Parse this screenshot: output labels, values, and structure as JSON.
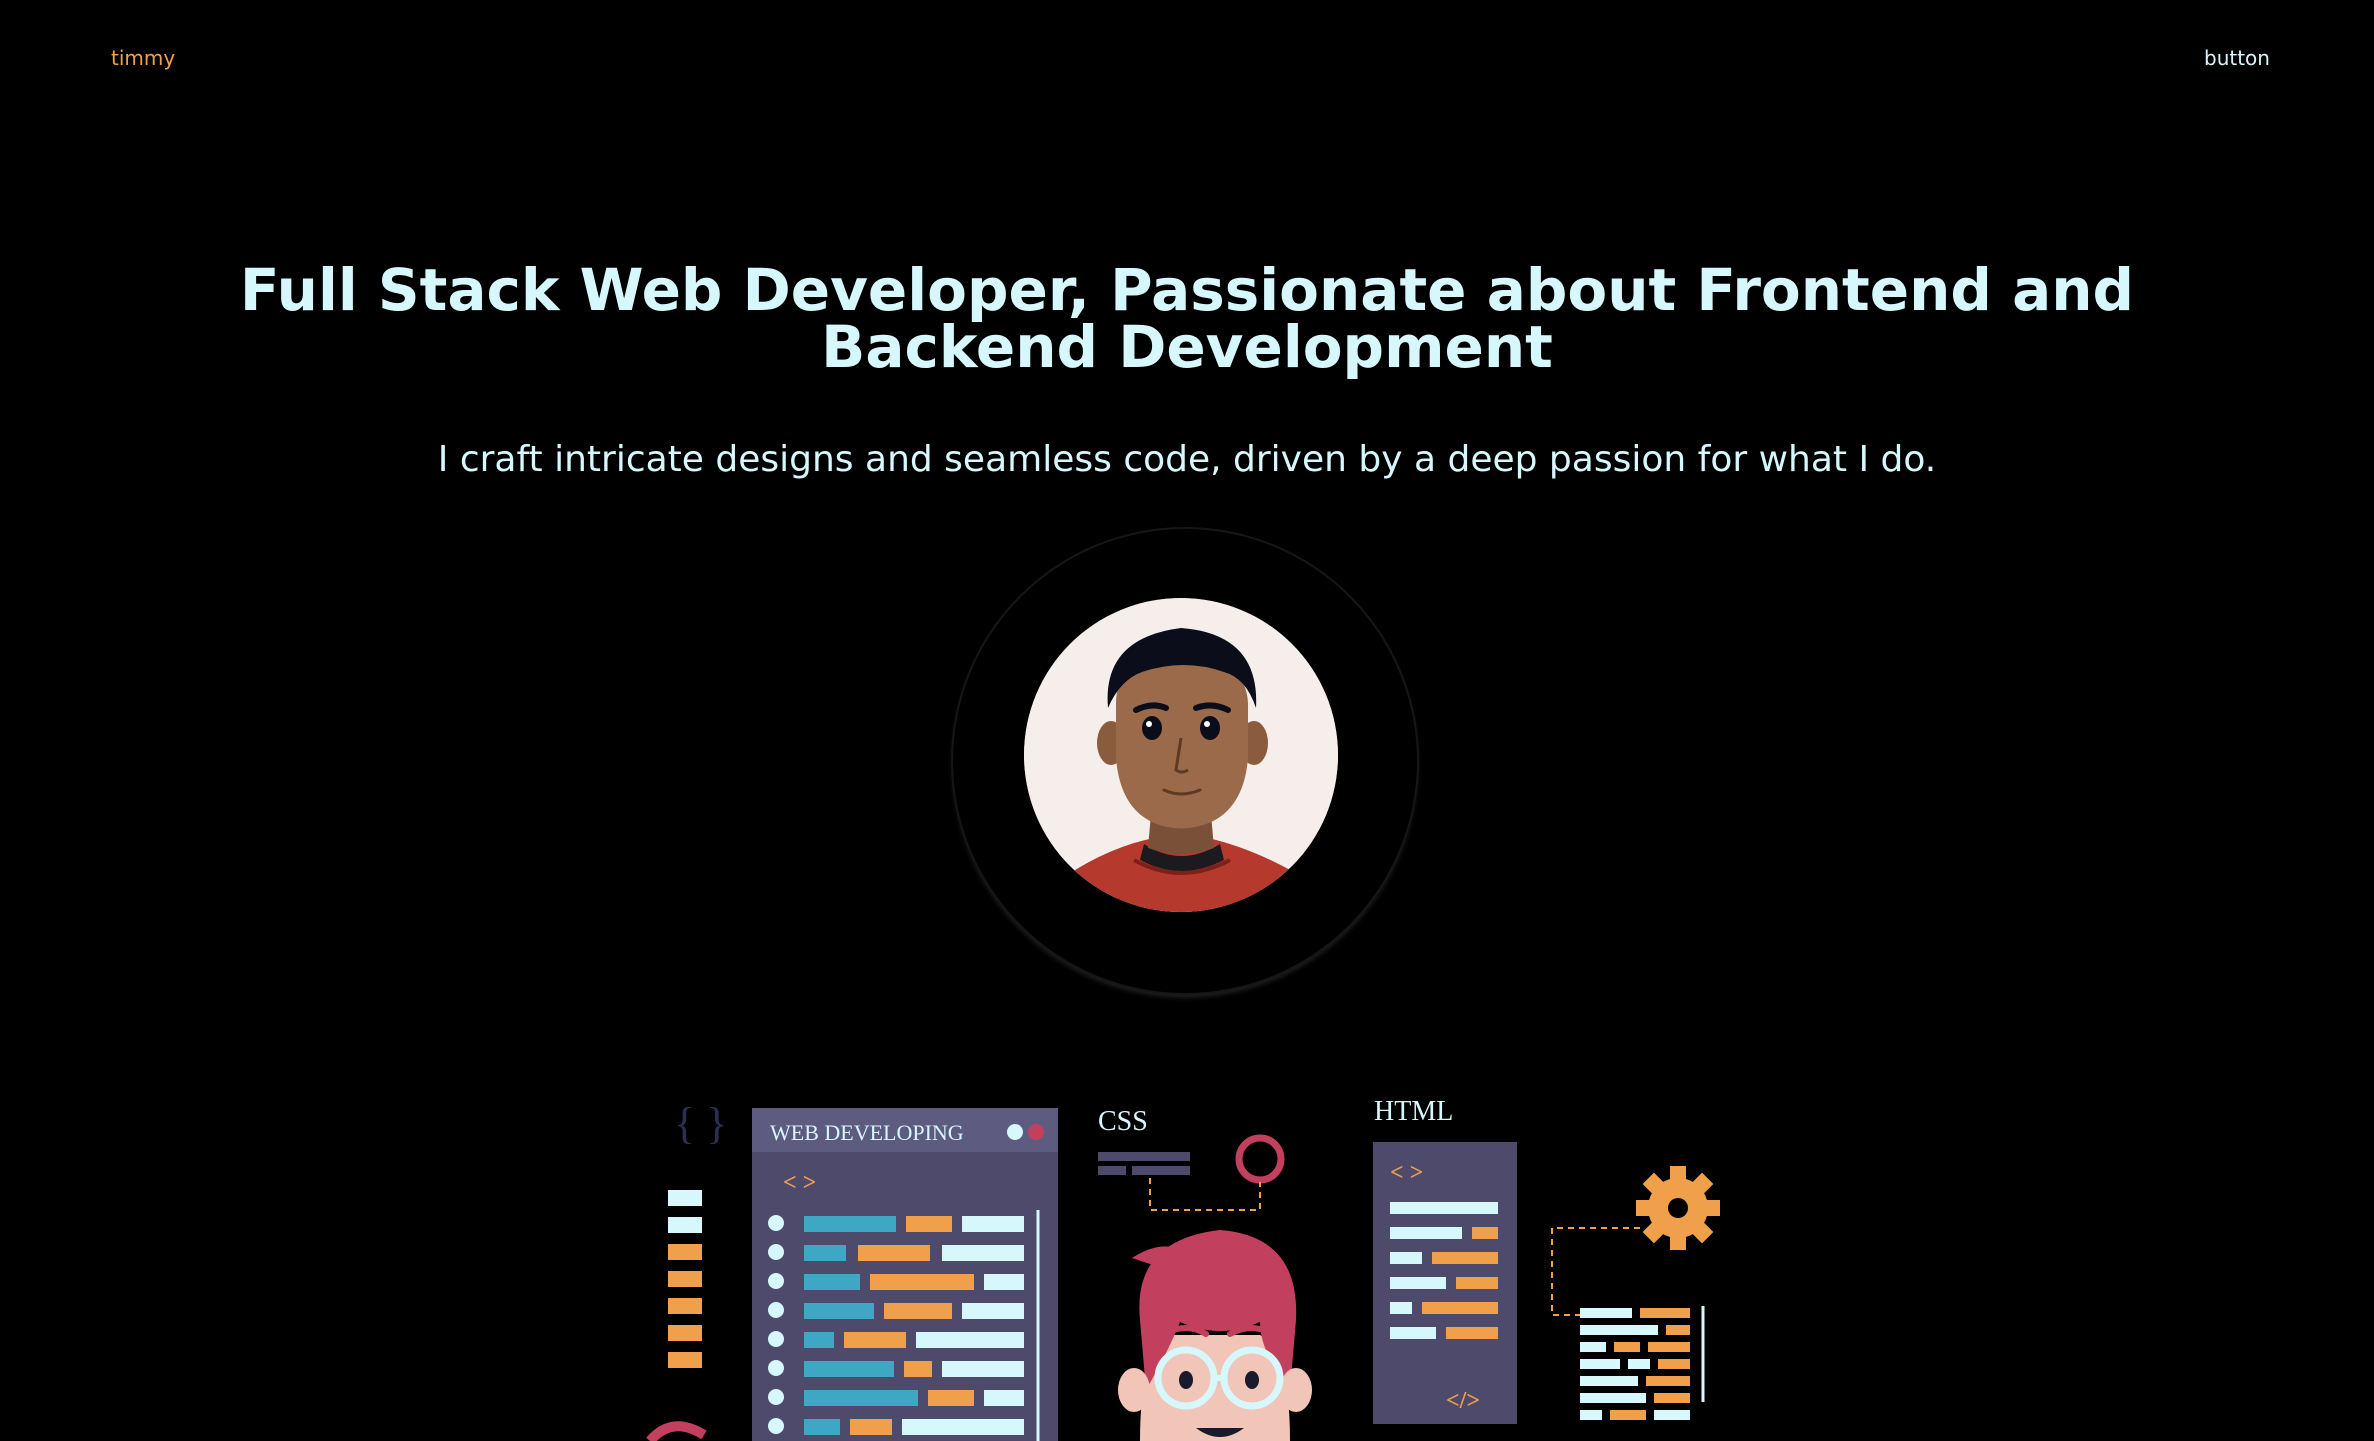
{
  "header": {
    "brand": "timmy",
    "button_label": "button"
  },
  "hero": {
    "headline": "Full Stack Web Developer, Passionate about Frontend and Backend Development",
    "subheadline": "I craft intricate designs and seamless code, driven by a deep passion for what I do."
  },
  "illustration": {
    "window_title": "WEB DEVELOPING",
    "css_label": "CSS",
    "html_label": "HTML",
    "open_tag": "< >",
    "close_tag": "</>",
    "braces": "{ }"
  },
  "colors": {
    "background": "#000000",
    "accent_text": "#d6f7fb",
    "brand_orange": "#f0a04b",
    "panel_purple": "#4d4a6b",
    "code_teal": "#3ea7c3",
    "code_light": "#d6f7fb",
    "magenta": "#c2405d"
  }
}
